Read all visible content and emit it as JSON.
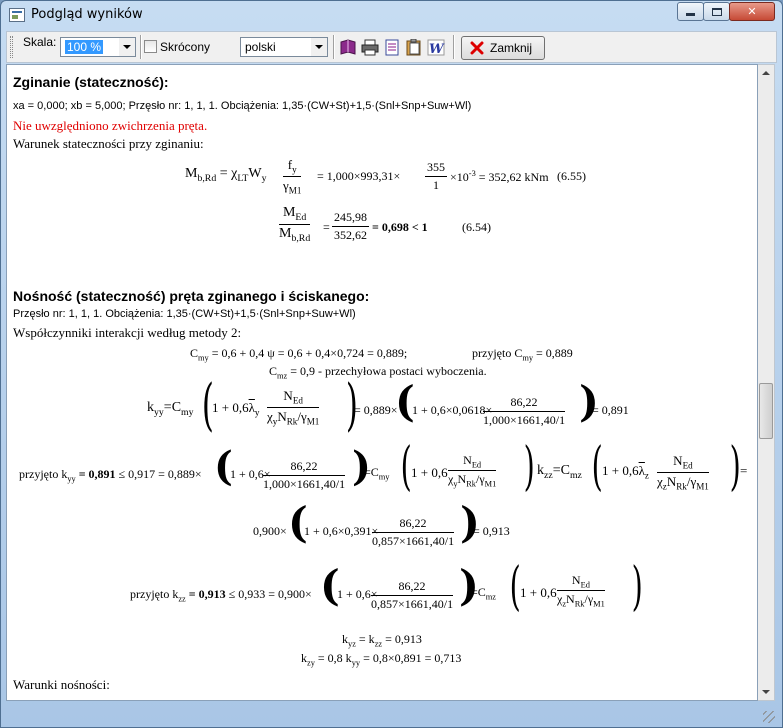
{
  "window": {
    "title": "Podgląd wyników",
    "min_label": "",
    "max_label": "",
    "close_label": "✕"
  },
  "toolbar": {
    "scale_label": "Skala:",
    "scale_value": "100 %",
    "short_label": "Skrócony",
    "language_value": "polski",
    "close_button_label": "Zamknij"
  },
  "report": {
    "section1": {
      "heading": "Zginanie (stateczność):",
      "params": "xa = 0,000;  xb = 5,000;  Przęsło nr: 1, 1, 1.  Obciążenia: 1,35·(CW+St)+1,5·(Snl+Snp+Suw+Wl)",
      "warning": "Nie uwzględniono zwichrzenia pręta.",
      "condition": "Warunek stateczności przy zginaniu:",
      "eq1_lhs": "M",
      "eq1_lhs_sub": "b,Rd",
      "eq1_mid": "= χ",
      "eq1_chi_sub": "LT",
      "eq1_w": "W",
      "eq1_w_sub": "y",
      "eq1_f": "f",
      "eq1_f_sub": "y",
      "eq1_gamma": "γ",
      "eq1_gamma_sub": "M1",
      "eq1_calc": "= 1,000×993,31×",
      "eq1_frac_num": "355",
      "eq1_frac_den": "1",
      "eq1_result": "×10",
      "eq1_exp": "-3",
      "eq1_tail": " = 352,62 kNm",
      "eq1_ref": "(6.55)",
      "eq2_num": "M",
      "eq2_num_sub": "Ed",
      "eq2_den": "M",
      "eq2_den_sub": "b,Rd",
      "eq2_eq": "=",
      "eq2_frac_num": "245,98",
      "eq2_frac_den": "352,62",
      "eq2_result": "= 0,698 < 1",
      "eq2_ref": "(6.54)"
    },
    "section2": {
      "heading": "Nośność (stateczność) pręta zginanego i ściskanego:",
      "params": "Przęsło nr: 1, 1, 1. Obciążenia: 1,35·(CW+St)+1,5·(Snl+Snp+Suw+Wl)",
      "coeff": "Współczynniki interakcji według metody 2:",
      "cmy_line": "C",
      "cmy_sub": "my",
      "cmy_rest": " = 0,6 + 0,4 ψ = 0,6 + 0,4×0,724 = 0,889;",
      "cmy_accept": "przyjęto C",
      "cmy_accept_sub": "my",
      "cmy_accept_val": " = 0,889",
      "cmz_line": "C",
      "cmz_sub": "mz",
      "cmz_rest": " = 0,9 - przechyłowa postaci wyboczenia.",
      "kyy_lhs": "k",
      "kyy_sub": "yy",
      "kyy_eq": "=C",
      "kyy_eq_sub": "my",
      "kyy_inner": "1 + 0,6",
      "kyy_lambda": "λ",
      "kyy_lambda_sub": "y",
      "frac_N": "N",
      "frac_N_sub": "Ed",
      "frac_chiy": "χ",
      "frac_chiy_sub": "y",
      "frac_NRk": "N",
      "frac_NRk_sub": "Rk",
      "frac_slash": "/",
      "frac_g": "γ",
      "frac_g_sub": "M1",
      "kyy_calc_pre": "= 0,889×",
      "kyy_calc_inner": "1 + 0,6×0,0618×",
      "kyy_calc_num": "86,22",
      "kyy_calc_den": "1,000×1661,40/1",
      "kyy_calc_post": "= 0,891",
      "acc_kyy_pre": "przyjęto k",
      "acc_kyy_sub": "yy",
      "acc_kyy_val": " = 0,891",
      "acc_kyy_rest": " ≤ 0,917 = 0,889×",
      "acc_kyy_inner": "1 + 0,6×",
      "acc_kyy_num": "86,22",
      "acc_kyy_den": "1,000×1661,40/1",
      "acc_kyy_eq": "=C",
      "acc_kyy_eq_sub": "my",
      "acc_kyy_inner2": "1 + 0,6",
      "kzz_lhs": "k",
      "kzz_sub": "zz",
      "kzz_eq": "=C",
      "kzz_eq_sub": "mz",
      "kzz_inner": "1 + 0,6",
      "kzz_lambda": "λ",
      "kzz_lambda_sub": "z",
      "frac_chiz": "χ",
      "frac_chiz_sub": "z",
      "trailing_eq": "=",
      "kzz_calc_pre": "0,900×",
      "kzz_calc_inner": "1 + 0,6×0,391×",
      "kzz_calc_num": "86,22",
      "kzz_calc_den": "0,857×1661,40/1",
      "kzz_calc_post": "= 0,913",
      "acc_kzz_pre": "przyjęto k",
      "acc_kzz_sub": "zz",
      "acc_kzz_val": " = 0,913",
      "acc_kzz_rest": " ≤ 0,933 = 0,900×",
      "acc_kzz_inner": "1 + 0,6×",
      "acc_kzz_num": "86,22",
      "acc_kzz_den": "0,857×1661,40/1",
      "acc_kzz_eq": "=C",
      "acc_kzz_eq_sub": "mz",
      "acc_kzz_inner2": "1 + 0,6",
      "kyz_line": "k",
      "kyz_sub": "yz",
      "kyz_mid": " = k",
      "kyz_mid_sub": "zz",
      "kyz_val": " = 0,913",
      "kzy_line": "k",
      "kzy_sub": "zy",
      "kzy_mid": " = 0,8 k",
      "kzy_mid_sub": "yy",
      "kzy_val": " = 0,8×0,891 = 0,713",
      "conditions": "Warunki nośności:"
    }
  }
}
